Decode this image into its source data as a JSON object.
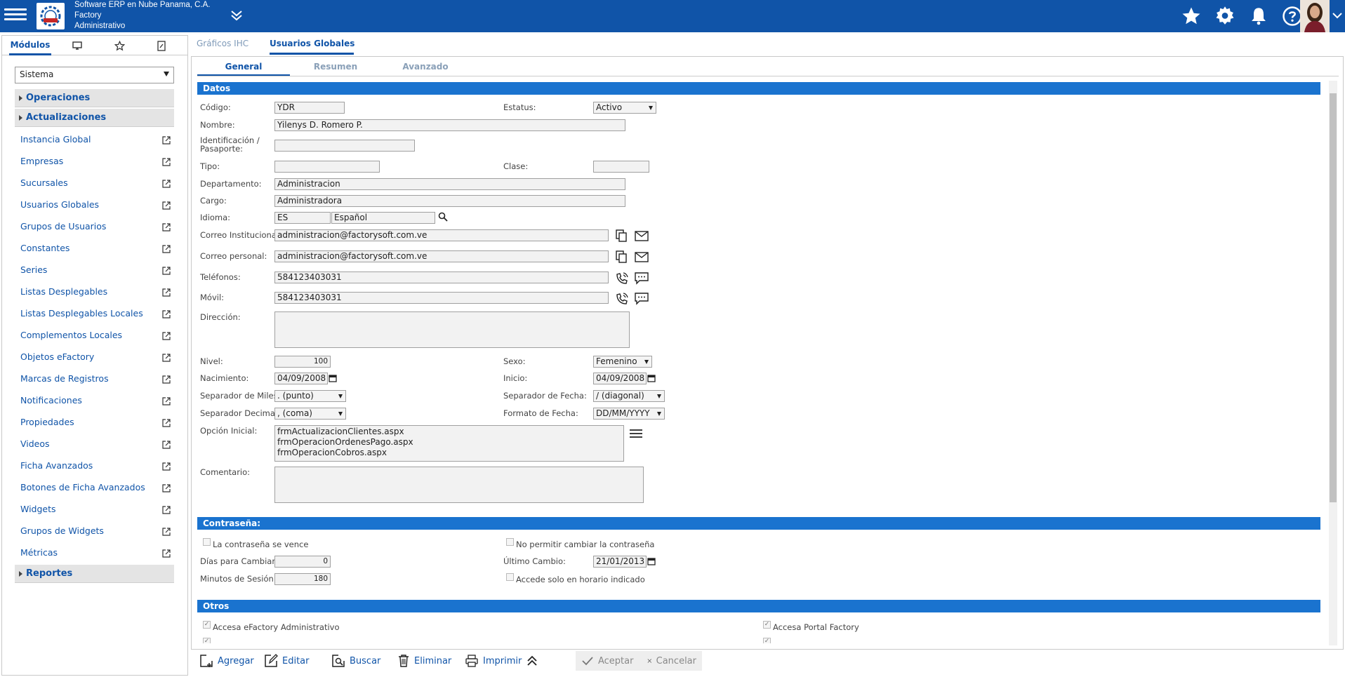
{
  "header": {
    "company_line1": "Software ERP en Nube Panama, C.A.",
    "company_line2": "Factory",
    "company_line3": "Administrativo"
  },
  "left_tabs": {
    "modules_label": "Módulos"
  },
  "sidebar": {
    "selector_value": "Sistema",
    "groups": [
      "Operaciones",
      "Actualizaciones",
      "Reportes"
    ],
    "items": [
      "Instancia Global",
      "Empresas",
      "Sucursales",
      "Usuarios Globales",
      "Grupos de Usuarios",
      "Constantes",
      "Series",
      "Listas Desplegables",
      "Listas Desplegables Locales",
      "Complementos Locales",
      "Objetos eFactory",
      "Marcas de Registros",
      "Notificaciones",
      "Propiedades",
      "Videos",
      "Ficha Avanzados",
      "Botones de Ficha Avanzados",
      "Widgets",
      "Grupos de Widgets",
      "Métricas"
    ]
  },
  "main_tabs": [
    "Gráficos IHC",
    "Usuarios Globales"
  ],
  "sub_tabs": [
    "General",
    "Resumen",
    "Avanzado"
  ],
  "sections": {
    "datos": "Datos",
    "password": "Contraseña:",
    "otros": "Otros"
  },
  "form": {
    "codigo_label": "Código:",
    "codigo": "YDR",
    "estatus_label": "Estatus:",
    "estatus": "Activo",
    "nombre_label": "Nombre:",
    "nombre": "Yilenys D. Romero P.",
    "ident_label_1": "Identificación /",
    "ident_label_2": "Pasaporte:",
    "ident": "",
    "tipo_label": "Tipo:",
    "tipo": "",
    "clase_label": "Clase:",
    "clase": "",
    "departamento_label": "Departamento:",
    "departamento": "Administracion",
    "cargo_label": "Cargo:",
    "cargo": "Administradora",
    "idioma_label": "Idioma:",
    "idioma_code": "ES",
    "idioma_name": "Español",
    "correo_inst_label": "Correo Institucional:",
    "correo_inst": "administracion@factorysoft.com.ve",
    "correo_pers_label": "Correo personal:",
    "correo_pers": "administracion@factorysoft.com.ve",
    "telefonos_label": "Teléfonos:",
    "telefonos": "584123403031",
    "movil_label": "Móvil:",
    "movil": "584123403031",
    "direccion_label": "Dirección:",
    "direccion": "",
    "nivel_label": "Nivel:",
    "nivel": "100",
    "sexo_label": "Sexo:",
    "sexo": "Femenino",
    "nacimiento_label": "Nacimiento:",
    "nacimiento": "04/09/2008",
    "inicio_label": "Inicio:",
    "inicio": "04/09/2008",
    "sep_miles_label": "Separador de Miles:",
    "sep_miles": ". (punto)",
    "sep_fecha_label": "Separador de Fecha:",
    "sep_fecha": "/ (diagonal)",
    "sep_dec_label": "Separador Decimales:",
    "sep_dec": ", (coma)",
    "formato_fecha_label": "Formato de Fecha:",
    "formato_fecha": "DD/MM/YYYY",
    "opcion_inicial_label": "Opción Inicial:",
    "opcion_inicial": [
      "frmActualizacionClientes.aspx",
      "frmOperacionOrdenesPago.aspx",
      "frmOperacionCobros.aspx"
    ],
    "comentario_label": "Comentario:",
    "comentario": ""
  },
  "password": {
    "vence_label": "La contraseña se vence",
    "no_cambiar_label": "No permitir cambiar la contraseña",
    "dias_label": "Días para Cambiar:",
    "dias": "0",
    "ultimo_cambio_label": "Último Cambio:",
    "ultimo_cambio": "21/01/2013",
    "minutos_label": "Minutos de Sesión:",
    "minutos": "180",
    "horario_label": "Accede solo en horario indicado"
  },
  "otros": {
    "accesa_admin": "Accesa eFactory Administrativo",
    "accesa_portal": "Accesa Portal Factory"
  },
  "toolbar": {
    "agregar": "Agregar",
    "editar": "Editar",
    "buscar": "Buscar",
    "eliminar": "Eliminar",
    "imprimir": "Imprimir",
    "aceptar": "Aceptar",
    "cancelar": "Cancelar"
  },
  "colors": {
    "brand": "#1054a8",
    "section": "#1a73cf"
  }
}
